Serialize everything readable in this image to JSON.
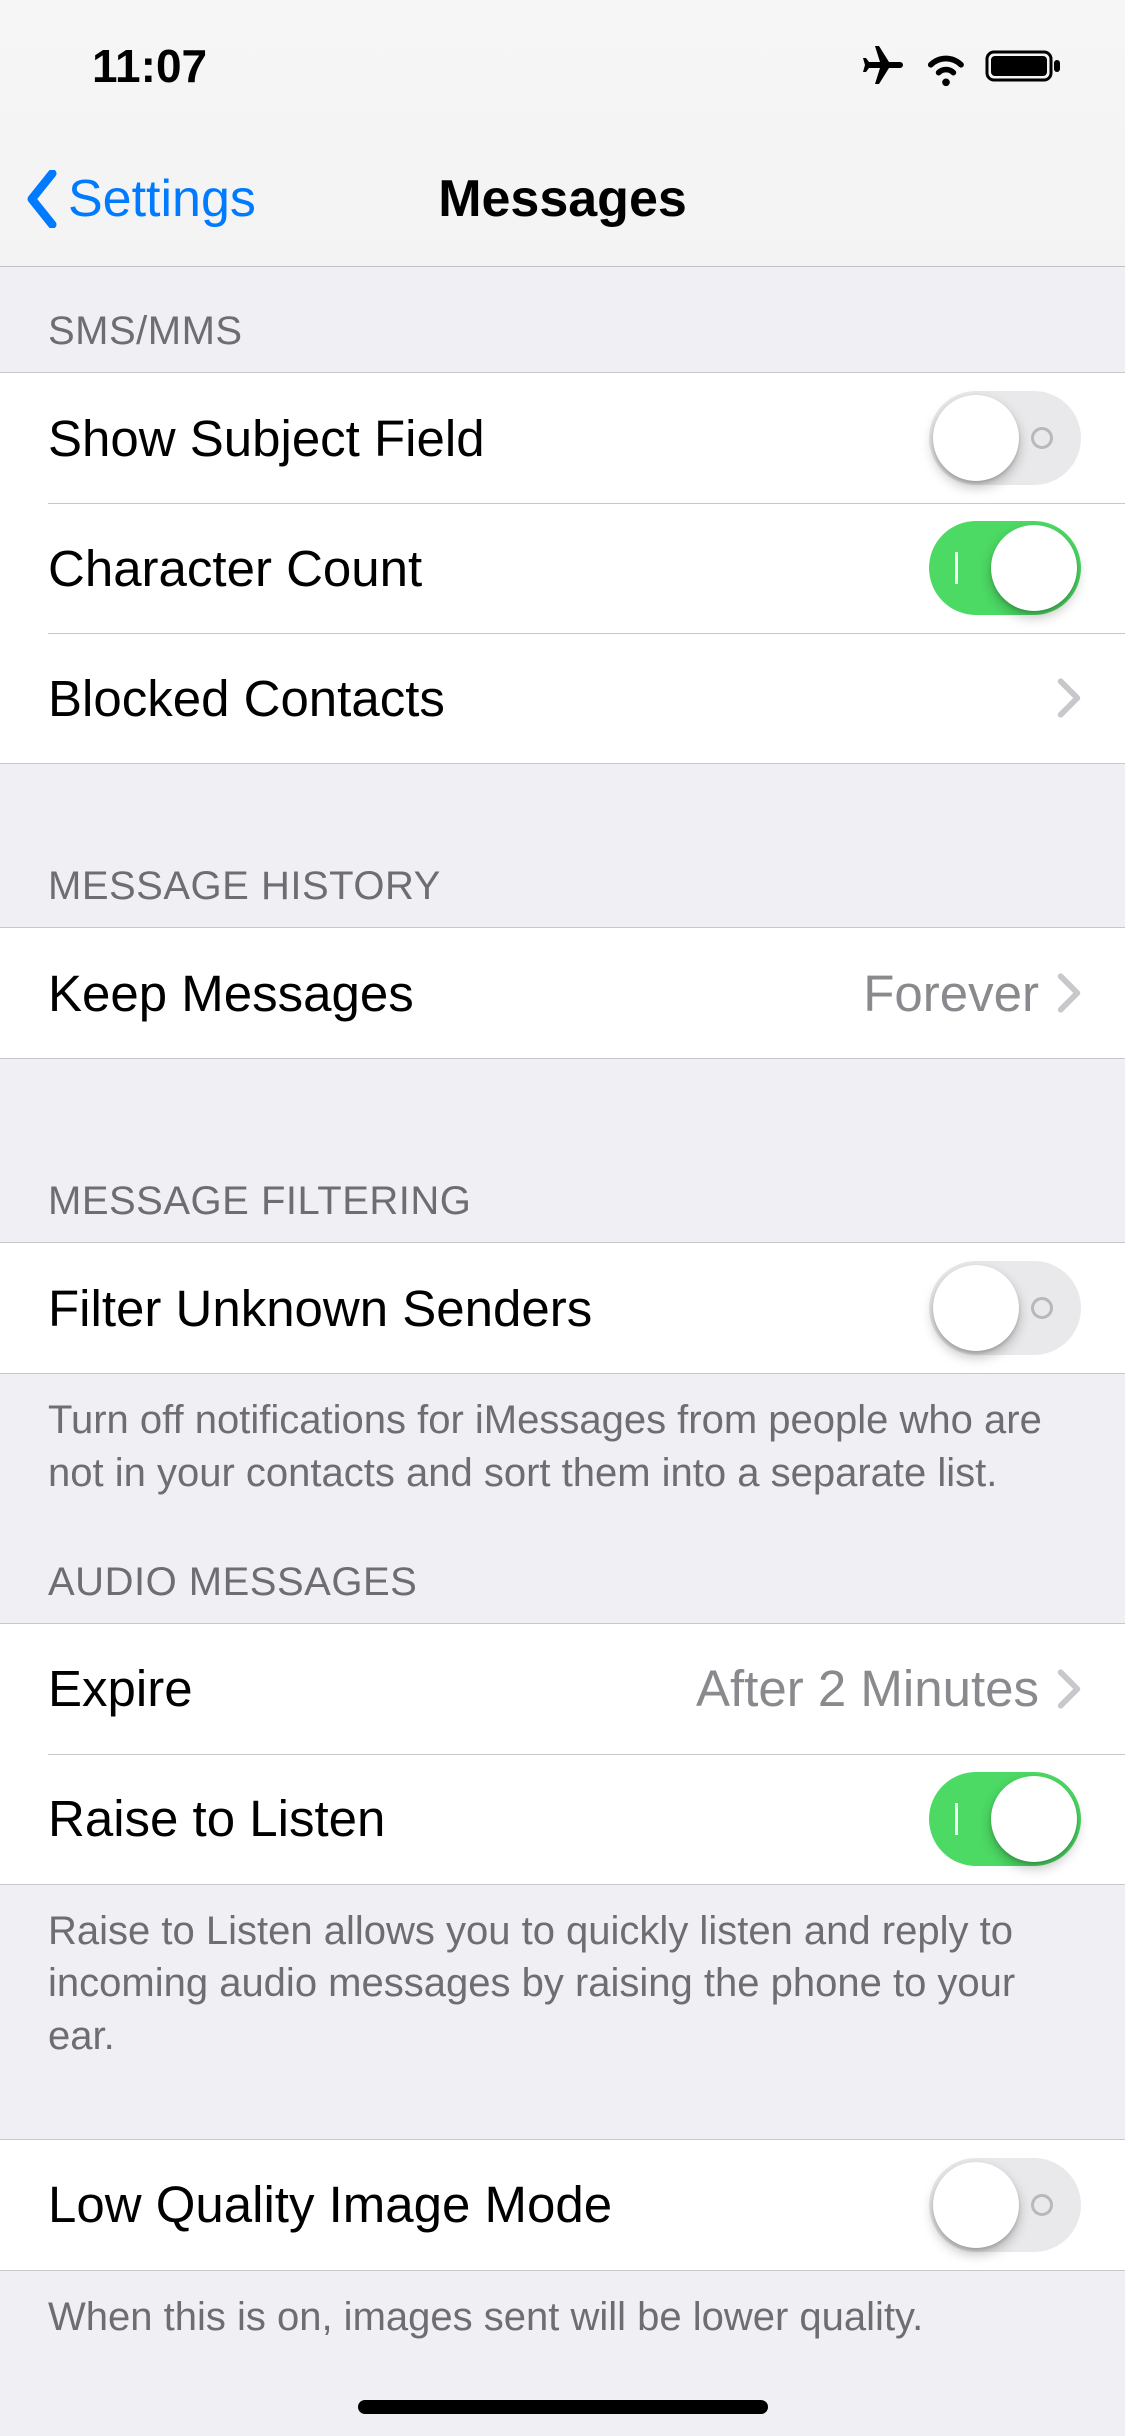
{
  "status": {
    "time": "11:07"
  },
  "nav": {
    "back": "Settings",
    "title": "Messages"
  },
  "sections": {
    "sms": {
      "header": "SMS/MMS",
      "show_subject": "Show Subject Field",
      "character_count": "Character Count",
      "blocked_contacts": "Blocked Contacts"
    },
    "history": {
      "header": "MESSAGE HISTORY",
      "keep_messages": "Keep Messages",
      "keep_messages_value": "Forever"
    },
    "filtering": {
      "header": "MESSAGE FILTERING",
      "filter_unknown": "Filter Unknown Senders",
      "filter_footer": "Turn off notifications for iMessages from people who are not in your contacts and sort them into a separate list."
    },
    "audio": {
      "header": "AUDIO MESSAGES",
      "expire": "Expire",
      "expire_value": "After 2 Minutes",
      "raise": "Raise to Listen",
      "raise_footer": "Raise to Listen allows you to quickly listen and reply to incoming audio messages by raising the phone to your ear."
    },
    "low_quality": {
      "label": "Low Quality Image Mode",
      "footer": "When this is on, images sent will be lower quality."
    }
  },
  "toggles": {
    "show_subject": false,
    "character_count": true,
    "filter_unknown": false,
    "raise_to_listen": true,
    "low_quality": false
  }
}
